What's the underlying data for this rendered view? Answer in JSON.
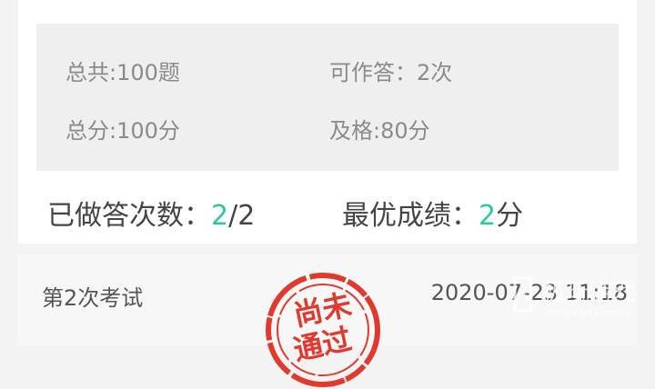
{
  "summary": {
    "total_questions": "总共:100题",
    "attempts_allowed": "可作答：2次",
    "total_score": "总分:100分",
    "passing": "及格:80分"
  },
  "stats": {
    "answered_label": "已做答次数：",
    "answered_count": "2",
    "answered_total": "/2",
    "best_label": "最优成绩：",
    "best_score": "2",
    "best_unit": "分"
  },
  "exam": {
    "name": "第2次考试",
    "date": "2020-07-23 11:18",
    "stamp_text": "尚未通过",
    "stamp_color": "#e03a2f"
  },
  "watermark": {
    "main": "极玩游戏",
    "sub": "Rengwan Games"
  },
  "colors": {
    "accent": "#2fc7a1"
  }
}
